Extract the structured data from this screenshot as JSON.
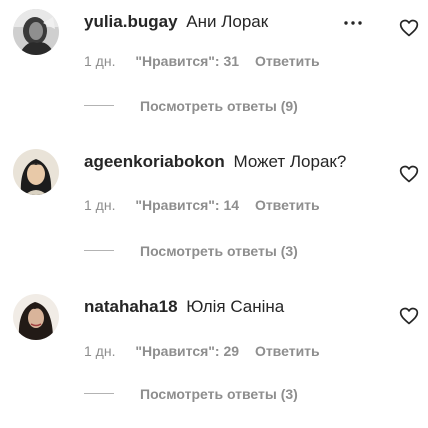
{
  "comments": [
    {
      "username": "yulia.bugay",
      "text": "Ани Лорак",
      "time": "1 дн.",
      "likes": "\"Нравится\": 31",
      "reply": "Ответить",
      "view_replies": "Посмотреть ответы (9)",
      "avatar_icon": "user-avatar-1",
      "has_more_menu": true
    },
    {
      "username": "ageenkoriabokon",
      "text": "Может Лорак?",
      "time": "1 дн.",
      "likes": "\"Нравится\": 14",
      "reply": "Ответить",
      "view_replies": "Посмотреть ответы (3)",
      "avatar_icon": "user-avatar-2",
      "has_more_menu": false
    },
    {
      "username": "natahaha18",
      "text": "Юлія Саніна",
      "time": "1 дн.",
      "likes": "\"Нравится\": 29",
      "reply": "Ответить",
      "view_replies": "Посмотреть ответы (3)",
      "avatar_icon": "user-avatar-3",
      "has_more_menu": false
    }
  ],
  "icons": {
    "like": "heart-icon",
    "more": "more-options-icon"
  },
  "colors": {
    "primary_text": "#262626",
    "secondary_text": "#8e8e8e",
    "background": "#ffffff"
  }
}
